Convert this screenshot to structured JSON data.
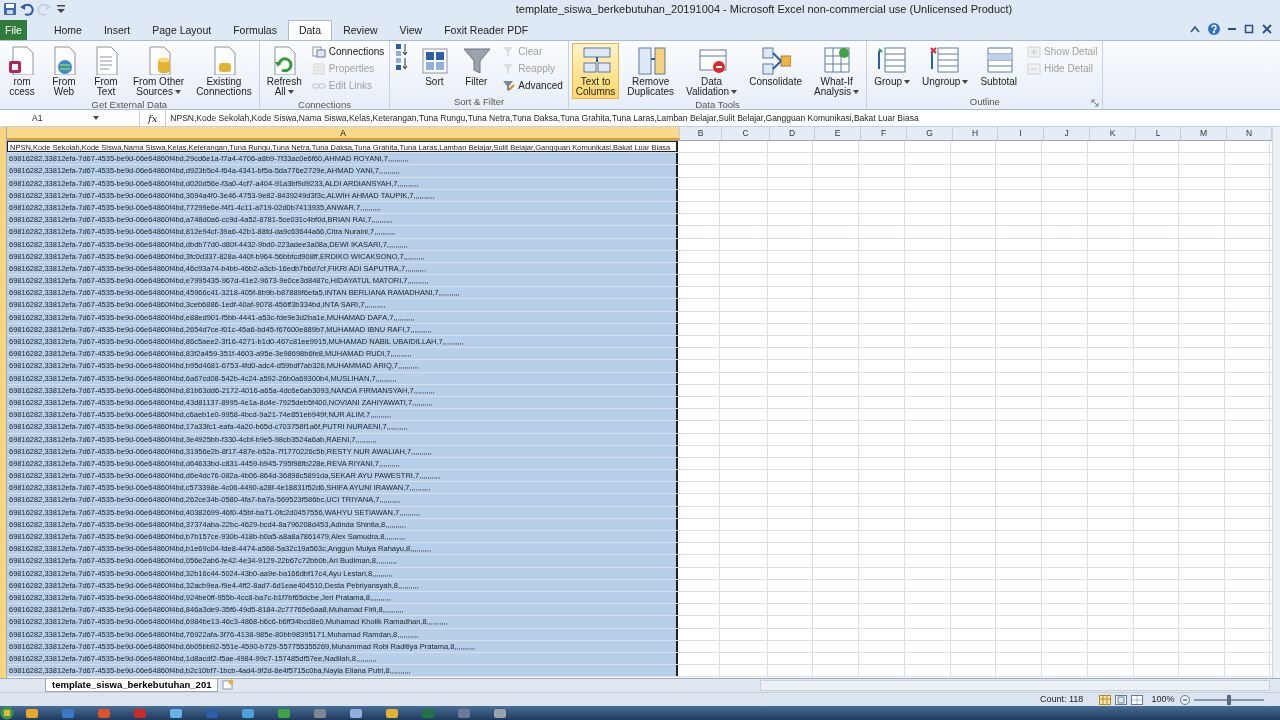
{
  "window": {
    "title": "template_siswa_berkebutuhan_20191004  -  Microsoft Excel non-commercial use (Unlicensed Product)"
  },
  "quick_access": [
    {
      "kind": "save",
      "disabled": false
    },
    {
      "kind": "undo",
      "disabled": false
    },
    {
      "kind": "redo",
      "disabled": true
    },
    {
      "kind": "customize",
      "disabled": false
    }
  ],
  "ribbon_tabs": [
    {
      "label": "File",
      "kind": "file",
      "selected": false
    },
    {
      "label": "Home",
      "kind": "tab",
      "selected": false
    },
    {
      "label": "Insert",
      "kind": "tab",
      "selected": false
    },
    {
      "label": "Page Layout",
      "kind": "tab",
      "selected": false
    },
    {
      "label": "Formulas",
      "kind": "tab",
      "selected": false
    },
    {
      "label": "Data",
      "kind": "tab",
      "selected": true
    },
    {
      "label": "Review",
      "kind": "tab",
      "selected": false
    },
    {
      "label": "View",
      "kind": "tab",
      "selected": false
    },
    {
      "label": "Foxit Reader PDF",
      "kind": "tab",
      "selected": false
    }
  ],
  "ribbon_groups": [
    {
      "title": "Get External Data",
      "items": [
        {
          "kind": "large",
          "lines": [
            "rom",
            "ccess"
          ]
        },
        {
          "kind": "large",
          "lines": [
            "From",
            "Web"
          ]
        },
        {
          "kind": "large",
          "lines": [
            "From",
            "Text"
          ]
        },
        {
          "kind": "large",
          "lines": [
            "From Other",
            "Sources"
          ],
          "dropdown": true
        },
        {
          "kind": "large",
          "lines": [
            "Existing",
            "Connections"
          ]
        }
      ]
    },
    {
      "title": "Connections",
      "items": [
        {
          "kind": "large",
          "lines": [
            "Refresh",
            "All"
          ],
          "dropdown": true
        },
        {
          "kind": "stack",
          "buttons": [
            {
              "label": "Connections",
              "disabled": false
            },
            {
              "label": "Properties",
              "disabled": true
            },
            {
              "label": "Edit Links",
              "disabled": true
            }
          ]
        }
      ]
    },
    {
      "title": "Sort & Filter",
      "items": [
        {
          "kind": "stack",
          "buttons": [
            {
              "disabled": false
            },
            {
              "disabled": false
            }
          ]
        },
        {
          "kind": "large",
          "lines": [
            "Sort"
          ]
        },
        {
          "kind": "large",
          "lines": [
            "Filter"
          ]
        },
        {
          "kind": "stack",
          "buttons": [
            {
              "label": "Clear",
              "disabled": true
            },
            {
              "label": "Reapply",
              "disabled": true
            },
            {
              "label": "Advanced",
              "disabled": false
            }
          ]
        }
      ]
    },
    {
      "title": "Data Tools",
      "items": [
        {
          "kind": "large",
          "lines": [
            "Text to",
            "Columns"
          ],
          "hovered": true
        },
        {
          "kind": "large",
          "lines": [
            "Remove",
            "Duplicates"
          ]
        },
        {
          "kind": "large",
          "lines": [
            "Data",
            "Validation"
          ],
          "dropdown": true
        },
        {
          "kind": "large",
          "lines": [
            "Consolidate"
          ]
        },
        {
          "kind": "large",
          "lines": [
            "What-If",
            "Analysis"
          ],
          "dropdown": true
        }
      ]
    },
    {
      "title": "Outline",
      "launcher": true,
      "items": [
        {
          "kind": "large",
          "lines": [
            "Group"
          ],
          "dropdown": true
        },
        {
          "kind": "large",
          "lines": [
            "Ungroup"
          ],
          "dropdown": true
        },
        {
          "kind": "large",
          "lines": [
            "Subtotal"
          ]
        },
        {
          "kind": "stack",
          "buttons": [
            {
              "label": "Show Detail",
              "disabled": true
            },
            {
              "label": "Hide Detail",
              "disabled": true
            }
          ]
        }
      ]
    }
  ],
  "formula_bar": {
    "name_box": "A1",
    "fx": "fx",
    "formula": "NPSN,Kode Sekolah,Kode Siswa,Nama Siswa,Kelas,Keterangan,Tuna Rungu,Tuna Netra,Tuna Daksa,Tuna Grahita,Tuna Laras,Lamban Belajar,Sulit Belajar,Gangguan Komunikasi,Bakat Luar Biasa"
  },
  "sheet": {
    "columns": [
      {
        "label": "A",
        "selected": true
      },
      {
        "label": "B",
        "selected": false
      },
      {
        "label": "C",
        "selected": false
      },
      {
        "label": "D",
        "selected": false
      },
      {
        "label": "E",
        "selected": false
      },
      {
        "label": "F",
        "selected": false
      },
      {
        "label": "G",
        "selected": false
      },
      {
        "label": "H",
        "selected": false
      },
      {
        "label": "I",
        "selected": false
      },
      {
        "label": "J",
        "selected": false
      },
      {
        "label": "K",
        "selected": false
      },
      {
        "label": "L",
        "selected": false
      },
      {
        "label": "M",
        "selected": false
      },
      {
        "label": "N",
        "selected": false
      }
    ],
    "rows": [
      {
        "text": "NPSN,Kode Sekolah,Kode Siswa,Nama Siswa,Kelas,Keterangan,Tuna Rungu,Tuna Netra,Tuna Daksa,Tuna Grahita,Tuna Laras,Lamban Belajar,Sulit Belajar,Gangguan Komunikasi,Bakat Luar Biasa",
        "selected": false,
        "active": true
      },
      {
        "text": "69816282,33812efa-7d67-4535-be9d-06e64860f4bd,29cd6e1a-f7a4-4706-a8b9-7f33ac0e6f60,AHMAD ROYANI,7,,,,,,,,,,",
        "selected": true
      },
      {
        "text": "69816282,33812efa-7d67-4535-be9d-06e64860f4bd,d923b5c4-f64a-4341-bf5a-5da776e2729e,AHMAD YANI,7,,,,,,,,,,",
        "selected": true
      },
      {
        "text": "69816282,33812efa-7d67-4535-be9d-06e64860f4bd,d020d56e-f3a0-4cf7-a404-91a3bf9d9233,ALDI ARDIANSYAH,7,,,,,,,,,,",
        "selected": true
      },
      {
        "text": "69816282,33812efa-7d67-4535-be9d-06e64860f4bd,3694a4f0-3e46-4753-9e82-8439249d3f3c,ALWIH AHMAD TAUPIK,7,,,,,,,,,,",
        "selected": true
      },
      {
        "text": "69816282,33812efa-7d67-4535-be9d-06e64860f4bd,77299e6e-f4f1-4c11-a719-02d0b7413935,ANWAR,7,,,,,,,,,,",
        "selected": true
      },
      {
        "text": "69816282,33812efa-7d67-4535-be9d-06e64860f4bd,a748d0a6-cc9d-4a52-8781-5ce031c4bf0d,BRIAN RAI,7,,,,,,,,,,",
        "selected": true
      },
      {
        "text": "69816282,33812efa-7d67-4535-be9d-06e64860f4bd,812e94cf-39a6-42b1-88fd-da9c63644a66,Citra Nuraini,7,,,,,,,,,,",
        "selected": true
      },
      {
        "text": "69816282,33812efa-7d67-4535-be9d-06e64860f4bd,dbdb77d0-d80f-4432-9bd0-223adee3a08a,DEWI IKASARI,7,,,,,,,,,,",
        "selected": true
      },
      {
        "text": "69816282,33812efa-7d67-4535-be9d-06e64860f4bd,3fc0d337-828a-440f-b964-56bbfcd908ff,ERDIKO WICAKSONO,7,,,,,,,,,,",
        "selected": true
      },
      {
        "text": "69816282,33812efa-7d67-4535-be9d-06e64860f4bd,46c93a74-b4bb-46b2-a3cb-16edb7b6d7cf,FIKRI ADI SAPUTRA,7,,,,,,,,,,",
        "selected": true
      },
      {
        "text": "69816282,33812efa-7d67-4535-be9d-06e64860f4bd,e7995435-967d-41e2-9673-9e0ce3d8487c,HIDAYATUL MATORI,7,,,,,,,,,,",
        "selected": true
      },
      {
        "text": "69816282,33812efa-7d67-4535-be9d-06e64860f4bd,45966c41-3218-405f-8b9b-b87889f6efa5,INTAN BERLIANA RAMADHANI,7,,,,,,,,,,",
        "selected": true
      },
      {
        "text": "69816282,33812efa-7d67-4535-be9d-06e64860f4bd,3ceb6886-1edf-40af-9078-456ff3b334bd,INTA SARI,7,,,,,,,,,,",
        "selected": true
      },
      {
        "text": "69816282,33812efa-7d67-4535-be9d-06e64860f4bd,e88ed901-f5bb-4441-a53c-fde9e3d2ba1e,MUHAMAD DAFA,7,,,,,,,,,,",
        "selected": true
      },
      {
        "text": "69816282,33812efa-7d67-4535-be9d-06e64860f4bd,2654d7ce-f01c-45a6-bd45-f67600e889b7,MUHAMAD IBNU RAFI,7,,,,,,,,,,",
        "selected": true
      },
      {
        "text": "69816282,33812efa-7d67-4535-be9d-06e64860f4bd,86c5aee2-3f16-4271-b1d0-467c81ee9915,MUHAMAD NABIL UBAIDILLAH,7,,,,,,,,,,",
        "selected": true
      },
      {
        "text": "69816282,33812efa-7d67-4535-be9d-06e64860f4bd,83f2a459-351f-4603-a95e-3e98698b6fe8,MUHAMAD RUDI,7,,,,,,,,,,",
        "selected": true
      },
      {
        "text": "69816282,33812efa-7d67-4535-be9d-06e64860f4bd,b95d4681-6753-4fd0-adc4-d59bdf7ab326,MUHAMMAD ARIQ,7,,,,,,,,,,",
        "selected": true
      },
      {
        "text": "69816282,33812efa-7d67-4535-be9d-06e64860f4bd,6a67cd08-542b-4c24-a592-26b0a69300b4,MUSLIHAN,7,,,,,,,,,,",
        "selected": true
      },
      {
        "text": "69816282,33812efa-7d67-4535-be9d-06e64860f4bd,81b63dd6-2172-4016-a65a-4dc6e6ab3093,NANDA FIRMANSYAH,7,,,,,,,,,,",
        "selected": true
      },
      {
        "text": "69816282,33812efa-7d67-4535-be9d-06e64860f4bd,43d81137-8995-4e1a-8d4e-7925deb5f400,NOVIANI ZAHIYAWATI,7,,,,,,,,,,",
        "selected": true
      },
      {
        "text": "69816282,33812efa-7d67-4535-be9d-06e64860f4bd,c6aeb1e0-9958-4bcd-9a21-74e851eb949f,NUR ALIM,7,,,,,,,,,,",
        "selected": true
      },
      {
        "text": "69816282,33812efa-7d67-4535-be9d-06e64860f4bd,17a33fc1-eafa-4a20-b65d-c703758f1a6f,PUTRI NURAENI,7,,,,,,,,,,",
        "selected": true
      },
      {
        "text": "69816282,33812efa-7d67-4535-be9d-06e64860f4bd,3e4925bb-f330-4cbf-b9e5-98cb3524a6ab,RAENI,7,,,,,,,,,,",
        "selected": true
      },
      {
        "text": "69816282,33812efa-7d67-4535-be9d-06e64860f4bd,31956e2b-8f17-487e-b52a-7f1770226c5b,RESTY NUR AWALIAH,7,,,,,,,,,,",
        "selected": true
      },
      {
        "text": "69816282,33812efa-7d67-4535-be9d-06e64860f4bd,d64633bd-c831-4459-b945-795f98fb228e,REVA RIYANI,7,,,,,,,,,,",
        "selected": true
      },
      {
        "text": "69816282,33812efa-7d67-4535-be9d-06e64860f4bd,d6e4dc76-082a-4b06-864d-36898c5891da,SEKAR AYU PAWESTRI,7,,,,,,,,,,",
        "selected": true
      },
      {
        "text": "69816282,33812efa-7d67-4535-be9d-06e64860f4bd,c573398e-4c06-4490-a28f-4e18831f52d6,SHIFA AYUNI IRAWAN,7,,,,,,,,,,",
        "selected": true
      },
      {
        "text": "69816282,33812efa-7d67-4535-be9d-06e64860f4bd,262ce34b-0580-4fa7-ba7a-569523f586bc,UCI TRIYANA,7,,,,,,,,,,",
        "selected": true
      },
      {
        "text": "69816282,33812efa-7d67-4535-be9d-06e64860f4bd,40382699-46f0-45bf-ba71-0fc2d0457556,WAHYU SETIAWAN,7,,,,,,,,,,",
        "selected": true
      },
      {
        "text": "69816282,33812efa-7d67-4535-be9d-06e64860f4bd,37374aba-22bc-4629-bcd4-8a796208d453,Adinda Shintia,8,,,,,,,,,,",
        "selected": true
      },
      {
        "text": "69816282,33812efa-7d67-4535-be9d-06e64860f4bd,b7b157ce-930b-418b-b0a5-a8a8a7861479,Alex Samudra,8,,,,,,,,,,",
        "selected": true
      },
      {
        "text": "69816282,33812efa-7d67-4535-be9d-06e64860f4bd,b1e69c04-fde8-4474-a568-5a32c19a563c,Anggun Mulya Rahayu,8,,,,,,,,,,",
        "selected": true
      },
      {
        "text": "69816282,33812efa-7d67-4535-be9d-06e64860f4bd,056e2ab6-fe42-4e34-9129-22b67c72bb0b,Ari Budiman,8,,,,,,,,,,",
        "selected": true
      },
      {
        "text": "69816282,33812efa-7d67-4535-be9d-06e64860f4bd,32b16c44-5024-43b0-aa9e-ba166dbf17c4,Ayu Lestari,8,,,,,,,,,,",
        "selected": true
      },
      {
        "text": "69816282,33812efa-7d67-4535-be9d-06e64860f4bd,32acb9ea-f9e4-4ff2-8ad7-6d1eae404510,Desta Pebriyansyah,8,,,,,,,,,,",
        "selected": true
      },
      {
        "text": "69816282,33812efa-7d67-4535-be9d-06e64860f4bd,924be0ff-955b-4cc8-ba7c-b1f7bf65dcbe,Jeri Pratama,8,,,,,,,,,,",
        "selected": true
      },
      {
        "text": "69816282,33812efa-7d67-4535-be9d-06e64860f4bd,846a3de9-35f6-49d5-8184-2c77765e6aa8,Muhamad Firli,8,,,,,,,,,,",
        "selected": true
      },
      {
        "text": "69816282,33812efa-7d67-4535-be9d-06e64860f4bd,6984be13-46c3-4868-b6c6-b6ff34bcd8e0,Muhamad Kholik Ramadhan,8,,,,,,,,,,",
        "selected": true
      },
      {
        "text": "69816282,33812efa-7d67-4535-be9d-06e64860f4bd,76922afa-3f76-4138-985e-80bb98395171,Muhamad Ramdan,8,,,,,,,,,,",
        "selected": true
      },
      {
        "text": "69816282,33812efa-7d67-4535-be9d-06e64860f4bd,6b05bb92-551e-4590-b729-557755355269,Muhammad Robi Raditiya Pratama,8,,,,,,,,,,",
        "selected": true
      },
      {
        "text": "69816282,33812efa-7d67-4535-be9d-06e64860f4bd,1d8acdf2-f5ae-4984-99c7-157485df57ee,Nadilah,8,,,,,,,,,,",
        "selected": true
      },
      {
        "text": "69816282,33812efa-7d67-4535-be9d-06e64860f4bd,b2c10bf7-1bcb-4ad4-9f2d-8e4f5715c0ba,Nayla Eliana Putri,8,,,,,,,,,,",
        "selected": true
      }
    ]
  },
  "sheet_tabs": [
    {
      "label": "template_siswa_berkebutuhan_201",
      "selected": true
    }
  ],
  "status_bar": {
    "count": "Count: 118",
    "zoom": "100%",
    "zoom_slider": {
      "level": 0.5
    }
  }
}
